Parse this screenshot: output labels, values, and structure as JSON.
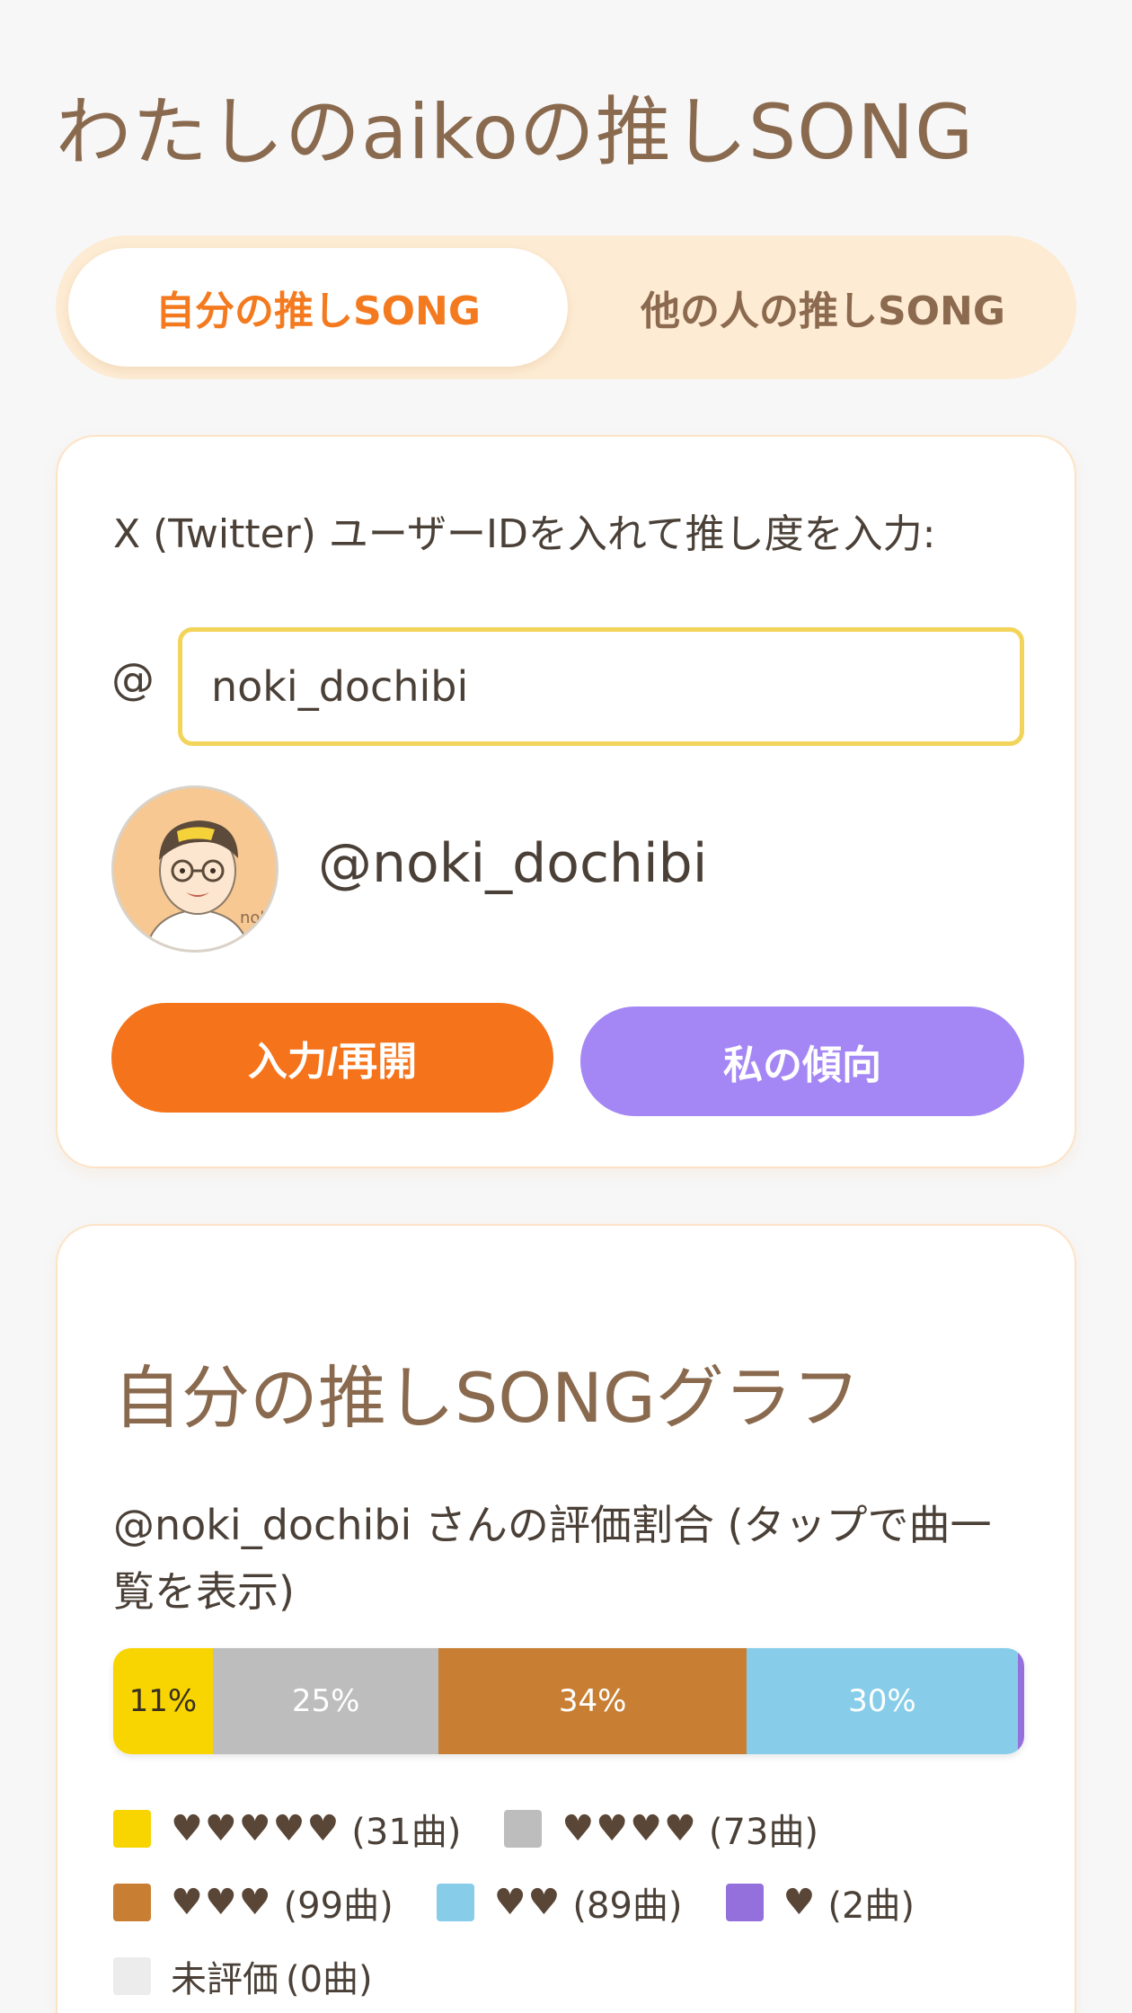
{
  "app": {
    "title": "わたしのaikoの推しSONG"
  },
  "tabs": [
    {
      "label": "自分の推しSONG",
      "active": true
    },
    {
      "label": "他の人の推しSONG",
      "active": false
    }
  ],
  "input_card": {
    "prompt": "X (Twitter) ユーザーIDを入れて推し度を入力:",
    "at_sign": "@",
    "user_id_value": "noki_dochibi",
    "handle": "@noki_dochibi",
    "resume_button": "入力/再開",
    "trend_button": "私の傾向"
  },
  "graph_card": {
    "title": "自分の推しSONGグラフ",
    "subtitle": "@noki_dochibi さんの評価割合 (タップで曲一覧を表示)"
  },
  "chart_data": {
    "type": "bar",
    "stacked": true,
    "orientation": "horizontal",
    "categories": [
      "♥♥♥♥♥",
      "♥♥♥♥",
      "♥♥♥",
      "♥♥",
      "♥",
      "未評価"
    ],
    "values_percent": [
      11,
      25,
      34,
      30,
      0.7,
      0
    ],
    "segment_labels": [
      "11%",
      "25%",
      "34%",
      "30%",
      "",
      ""
    ],
    "counts": [
      31,
      73,
      99,
      89,
      2,
      0
    ],
    "legend": [
      {
        "hearts": "♥♥♥♥♥",
        "count": "(31曲)",
        "color": "#f8d500"
      },
      {
        "hearts": "♥♥♥♥",
        "count": "(73曲)",
        "color": "#bdbdbd"
      },
      {
        "hearts": "♥♥♥",
        "count": "(99曲)",
        "color": "#c87f34"
      },
      {
        "hearts": "♥♥",
        "count": "(89曲)",
        "color": "#87cdea"
      },
      {
        "hearts": "♥",
        "count": "(2曲)",
        "color": "#9370db"
      },
      {
        "label": "未評価",
        "count": "(0曲)",
        "color": "#ececec"
      }
    ]
  },
  "colors": {
    "accent_orange": "#f4731b",
    "accent_purple": "#a487f4",
    "title_brown": "#8a6a4e"
  }
}
